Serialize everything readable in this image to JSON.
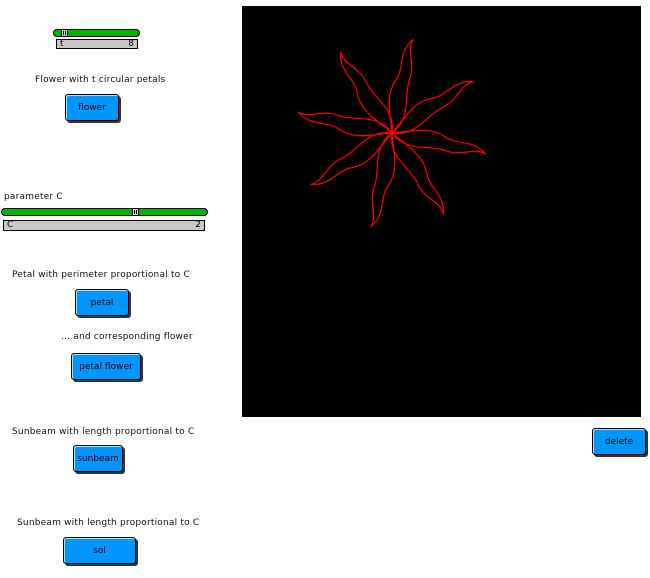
{
  "controls": {
    "t_slider": {
      "name": "t",
      "value": "8",
      "fraction": 0.1
    },
    "flower_caption": "Flower with t circular petals",
    "flower_button": "flower",
    "c_label": "parameter C",
    "c_slider": {
      "name": "C",
      "value": "2",
      "fraction": 0.65
    },
    "petal_caption": "Petal with perimeter proportional to C",
    "petal_button": "petal",
    "petal_flower_caption": "... and corresponding flower",
    "petal_flower_button": "petal flower",
    "sunbeam_caption": "Sunbeam with length proportional to C",
    "sunbeam_button": "sunbeam",
    "sol_caption": "Sunbeam with length proportional to C",
    "sol_button": "sol",
    "delete_button": "delete"
  },
  "colors": {
    "canvas_bg": "#000000",
    "drawing_stroke": "#ff0000",
    "button_fill": "#0096ff",
    "slider_fill": "#00b400"
  },
  "drawing": {
    "shape": "sunbeam flower",
    "petal_count": 8
  }
}
